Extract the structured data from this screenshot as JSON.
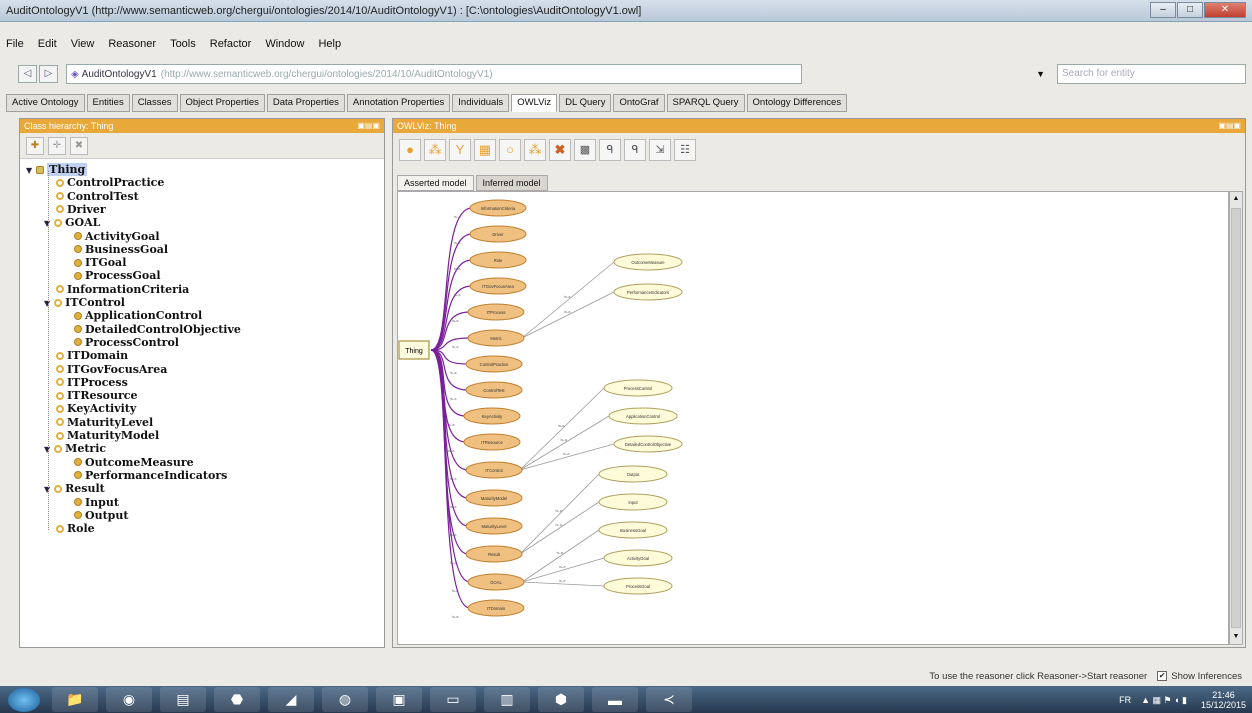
{
  "window": {
    "title": "AuditOntologyV1 (http://www.semanticweb.org/chergui/ontologies/2014/10/AuditOntologyV1) : [C:\\ontologies\\AuditOntologyV1.owl]"
  },
  "menu": [
    "File",
    "Edit",
    "View",
    "Reasoner",
    "Tools",
    "Refactor",
    "Window",
    "Help"
  ],
  "address": {
    "name": "AuditOntologyV1",
    "url": "(http://www.semanticweb.org/chergui/ontologies/2014/10/AuditOntologyV1)",
    "search_placeholder": "Search for entity"
  },
  "tabs": [
    "Active Ontology",
    "Entities",
    "Classes",
    "Object Properties",
    "Data Properties",
    "Annotation Properties",
    "Individuals",
    "OWLViz",
    "DL Query",
    "OntoGraf",
    "SPARQL Query",
    "Ontology Differences"
  ],
  "left_panel": {
    "header": "Class hierarchy: Thing"
  },
  "tree": [
    {
      "label": "Thing",
      "depth": 0
    },
    {
      "label": "ControlPractice",
      "depth": 1
    },
    {
      "label": "ControlTest",
      "depth": 1
    },
    {
      "label": "Driver",
      "depth": 1
    },
    {
      "label": "GOAL",
      "depth": 1
    },
    {
      "label": "ActivityGoal",
      "depth": 2
    },
    {
      "label": "BusinessGoal",
      "depth": 2
    },
    {
      "label": "ITGoal",
      "depth": 2
    },
    {
      "label": "ProcessGoal",
      "depth": 2
    },
    {
      "label": "InformationCriteria",
      "depth": 1
    },
    {
      "label": "ITControl",
      "depth": 1
    },
    {
      "label": "ApplicationControl",
      "depth": 2
    },
    {
      "label": "DetailedControlObjective",
      "depth": 2
    },
    {
      "label": "ProcessControl",
      "depth": 2
    },
    {
      "label": "ITDomain",
      "depth": 1
    },
    {
      "label": "ITGovFocusArea",
      "depth": 1
    },
    {
      "label": "ITProcess",
      "depth": 1
    },
    {
      "label": "ITResource",
      "depth": 1
    },
    {
      "label": "KeyActivity",
      "depth": 1
    },
    {
      "label": "MaturityLevel",
      "depth": 1
    },
    {
      "label": "MaturityModel",
      "depth": 1
    },
    {
      "label": "Metric",
      "depth": 1
    },
    {
      "label": "OutcomeMeasure",
      "depth": 2
    },
    {
      "label": "PerformanceIndicators",
      "depth": 2
    },
    {
      "label": "Result",
      "depth": 1
    },
    {
      "label": "Input",
      "depth": 2
    },
    {
      "label": "Output",
      "depth": 2
    },
    {
      "label": "Role",
      "depth": 1
    }
  ],
  "right_panel": {
    "header": "OWLViz: Thing",
    "subtabs": [
      "Asserted model",
      "Inferred model"
    ]
  },
  "graph": {
    "root": "Thing",
    "nodes": [
      "InformationCriteria",
      "Driver",
      "Role",
      "ITGovFocusArea",
      "ITProcess",
      "Metric",
      "ControlPractice",
      "ControlTest",
      "KeyActivity",
      "ITResource",
      "ITControl",
      "MaturityModel",
      "MaturityLevel",
      "Result",
      "GOAL",
      "ITDomain"
    ],
    "children": [
      {
        "label": "OutcomeMeasure",
        "parent": "Metric"
      },
      {
        "label": "PerformanceIndicators",
        "parent": "Metric"
      },
      {
        "label": "ProcessControl",
        "parent": "ITControl"
      },
      {
        "label": "ApplicationControl",
        "parent": "ITControl"
      },
      {
        "label": "DetailedControlObjective",
        "parent": "ITControl"
      },
      {
        "label": "Output",
        "parent": "Result"
      },
      {
        "label": "Input",
        "parent": "Result"
      },
      {
        "label": "BusinessGoal",
        "parent": "GOAL"
      },
      {
        "label": "ActivityGoal",
        "parent": "GOAL"
      },
      {
        "label": "ProcessGoal",
        "parent": "GOAL"
      }
    ],
    "edge_label": "is-a"
  },
  "status": {
    "message": "To use the reasoner click Reasoner->Start reasoner",
    "show_inferences": "Show Inferences"
  },
  "taskbar": {
    "lang": "FR",
    "time": "21:46",
    "date": "15/12/2015"
  },
  "colors": {
    "accent": "#e8a83a",
    "node_fill": "#f0c080",
    "child_fill": "#fdfbd8",
    "edge": "#7a1f9a"
  }
}
